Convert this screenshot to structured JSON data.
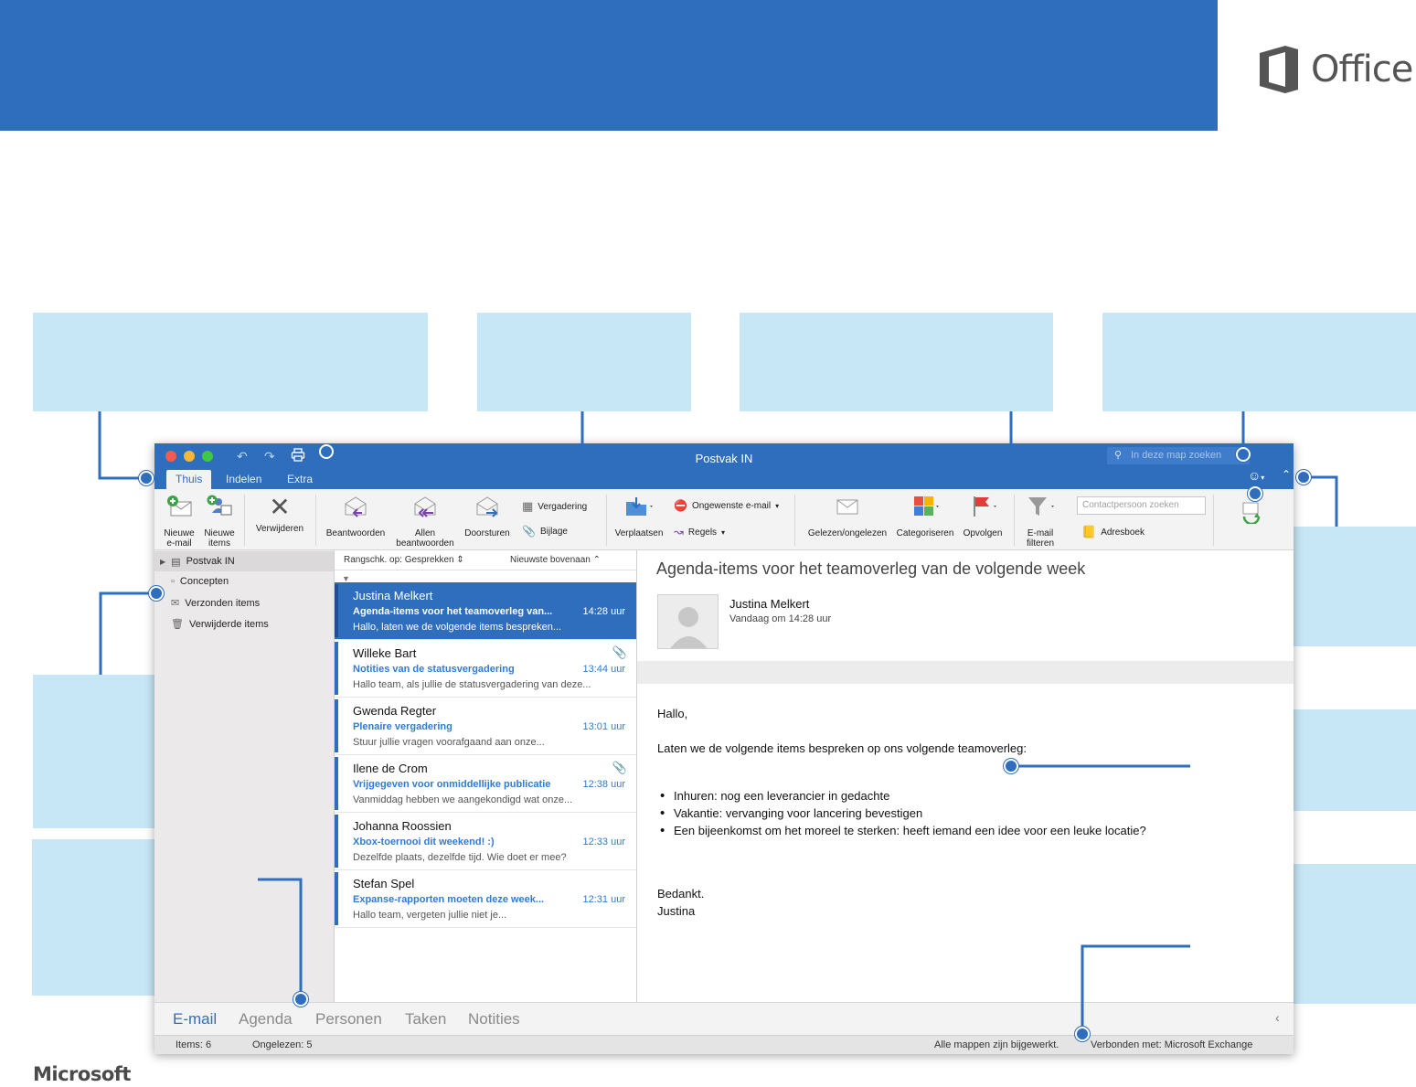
{
  "brand": {
    "office_word": "Office",
    "microsoft_word": "Microsoft"
  },
  "window": {
    "title": "Postvak IN",
    "search_placeholder": "In deze map zoeken",
    "tabs": [
      "Thuis",
      "Indelen",
      "Extra"
    ],
    "active_tab": "Thuis"
  },
  "ribbon": {
    "new_email": "Nieuwe\ne-mail",
    "new_items": "Nieuwe\nitems",
    "delete": "Verwijderen",
    "reply": "Beantwoorden",
    "reply_all": "Allen\nbeantwoorden",
    "forward": "Doorsturen",
    "meeting": "Vergadering",
    "attachment": "Bijlage",
    "move": "Verplaatsen",
    "junk": "Ongewenste e-mail",
    "rules": "Regels",
    "read_unread": "Gelezen/ongelezen",
    "categorize": "Categoriseren",
    "follow_up": "Opvolgen",
    "filter_email": "E-mail\nfilteren",
    "contact_search_placeholder": "Contactpersoon zoeken",
    "address_book": "Adresboek"
  },
  "folders": [
    {
      "label": "Postvak IN",
      "icon": "inbox-icon"
    },
    {
      "label": "Concepten",
      "icon": "drafts-icon"
    },
    {
      "label": "Verzonden items",
      "icon": "sent-icon"
    },
    {
      "label": "Verwijderde items",
      "icon": "trash-icon"
    }
  ],
  "list": {
    "sort_label": "Rangschk. op: Gesprekken",
    "order_label": "Nieuwste bovenaan",
    "messages": [
      {
        "from": "Justina Melkert",
        "subject": "Agenda-items voor het teamoverleg van...",
        "time": "14:28 uur",
        "preview": "Hallo, laten we de volgende items bespreken...",
        "attachment": false
      },
      {
        "from": "Willeke Bart",
        "subject": "Notities van de statusvergadering",
        "time": "13:44 uur",
        "preview": "Hallo team, als jullie de statusvergadering van deze...",
        "attachment": true
      },
      {
        "from": "Gwenda Regter",
        "subject": "Plenaire vergadering",
        "time": "13:01 uur",
        "preview": "Stuur jullie vragen voorafgaand aan onze...",
        "attachment": false
      },
      {
        "from": "Ilene de Crom",
        "subject": "Vrijgegeven voor onmiddellijke publicatie",
        "time": "12:38 uur",
        "preview": "Vanmiddag hebben we aangekondigd wat onze...",
        "attachment": true
      },
      {
        "from": "Johanna Roossien",
        "subject": "Xbox-toernooi dit weekend! :)",
        "time": "12:33 uur",
        "preview": "Dezelfde plaats, dezelfde tijd. Wie doet er mee?",
        "attachment": false
      },
      {
        "from": "Stefan Spel",
        "subject": "Expanse-rapporten moeten deze week...",
        "time": "12:31 uur",
        "preview": "Hallo team, vergeten jullie niet je...",
        "attachment": false
      }
    ]
  },
  "reading": {
    "subject": "Agenda-items voor het teamoverleg van de volgende week",
    "sender": "Justina Melkert",
    "date": "Vandaag om 14:28 uur",
    "greeting": "Hallo,",
    "intro": "Laten we de volgende items bespreken op ons volgende teamoverleg:",
    "bullets": [
      "Inhuren: nog een leverancier in gedachte",
      "Vakantie: vervanging voor lancering bevestigen",
      "Een bijeenkomst om het moreel te sterken: heeft iemand een idee voor een leuke locatie?"
    ],
    "closing": "Bedankt.",
    "signature": "Justina"
  },
  "nav": [
    "E-mail",
    "Agenda",
    "Personen",
    "Taken",
    "Notities"
  ],
  "status": {
    "items": "Items: 6",
    "unread": "Ongelezen: 5",
    "synced": "Alle mappen zijn bijgewerkt.",
    "connected": "Verbonden met: Microsoft Exchange"
  },
  "colors": {
    "brand_blue": "#2f6ebd",
    "callout": "#c7e6f6",
    "link_blue": "#2f7bd5"
  }
}
